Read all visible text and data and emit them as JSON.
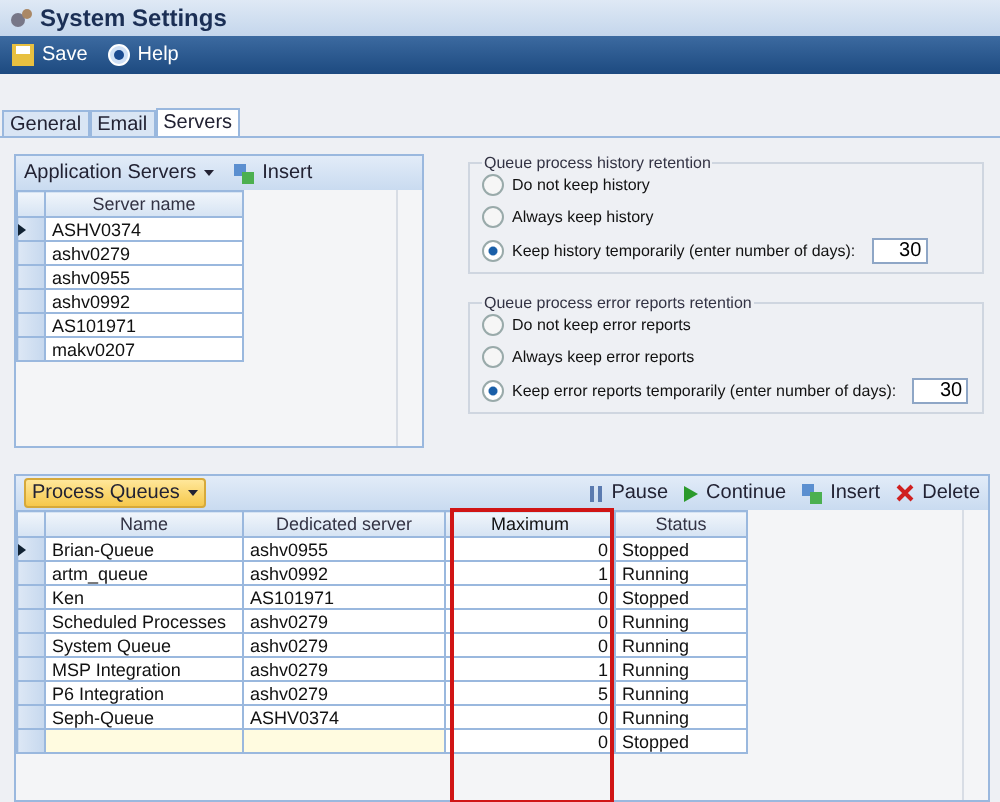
{
  "window": {
    "title": "System Settings"
  },
  "toolbar": [
    {
      "label": "Save",
      "kind": "save"
    },
    {
      "label": "Help",
      "kind": "help"
    }
  ],
  "tabs": [
    {
      "label": "General",
      "selected": false
    },
    {
      "label": "Email",
      "selected": false
    },
    {
      "label": "Servers",
      "selected": true
    }
  ],
  "servers_panel": {
    "dropdown": "Application Servers",
    "insert": "Insert",
    "column": "Server name",
    "rows": [
      {
        "name": "ASHV0374",
        "selected": true
      },
      {
        "name": "ashv0279",
        "selected": false
      },
      {
        "name": "ashv0955",
        "selected": false
      },
      {
        "name": "ashv0992",
        "selected": false
      },
      {
        "name": "AS101971",
        "selected": false
      },
      {
        "name": "makv0207",
        "selected": false
      }
    ]
  },
  "history_group": {
    "title": "Queue process history retention",
    "options": [
      {
        "label": "Do not keep history",
        "selected": false
      },
      {
        "label": "Always keep history",
        "selected": false
      },
      {
        "label": "Keep history temporarily (enter number of days):",
        "selected": true,
        "value": "30"
      }
    ]
  },
  "errors_group": {
    "title": "Queue process error reports retention",
    "options": [
      {
        "label": "Do not keep error reports",
        "selected": false
      },
      {
        "label": "Always keep error reports",
        "selected": false
      },
      {
        "label": "Keep error reports temporarily (enter number of days):",
        "selected": true,
        "value": "30"
      }
    ]
  },
  "queues_panel": {
    "dropdown": "Process Queues",
    "actions": [
      {
        "label": "Pause",
        "kind": "pause"
      },
      {
        "label": "Continue",
        "kind": "continue"
      },
      {
        "label": "Insert",
        "kind": "insert"
      },
      {
        "label": "Delete",
        "kind": "delete"
      }
    ],
    "columns": [
      {
        "label": "Name",
        "highlighted": false
      },
      {
        "label": "Dedicated server",
        "highlighted": false
      },
      {
        "label": "Maximum",
        "highlighted": true
      },
      {
        "label": "Status",
        "highlighted": false
      }
    ],
    "rows": [
      {
        "cells": [
          "Brian-Queue",
          "ashv0955",
          "0",
          "Stopped"
        ],
        "selected": true,
        "new": false
      },
      {
        "cells": [
          "artm_queue",
          "ashv0992",
          "1",
          "Running"
        ],
        "selected": false,
        "new": false
      },
      {
        "cells": [
          "Ken",
          "AS101971",
          "0",
          "Stopped"
        ],
        "selected": false,
        "new": false
      },
      {
        "cells": [
          "Scheduled Processes",
          "ashv0279",
          "0",
          "Running"
        ],
        "selected": false,
        "new": false
      },
      {
        "cells": [
          "System Queue",
          "ashv0279",
          "0",
          "Running"
        ],
        "selected": false,
        "new": false
      },
      {
        "cells": [
          "MSP Integration",
          "ashv0279",
          "1",
          "Running"
        ],
        "selected": false,
        "new": false
      },
      {
        "cells": [
          "P6 Integration",
          "ashv0279",
          "5",
          "Running"
        ],
        "selected": false,
        "new": false
      },
      {
        "cells": [
          "Seph-Queue",
          "ASHV0374",
          "0",
          "Running"
        ],
        "selected": false,
        "new": false
      },
      {
        "cells": [
          "",
          "",
          "0",
          "Stopped"
        ],
        "selected": false,
        "new": true
      }
    ]
  }
}
